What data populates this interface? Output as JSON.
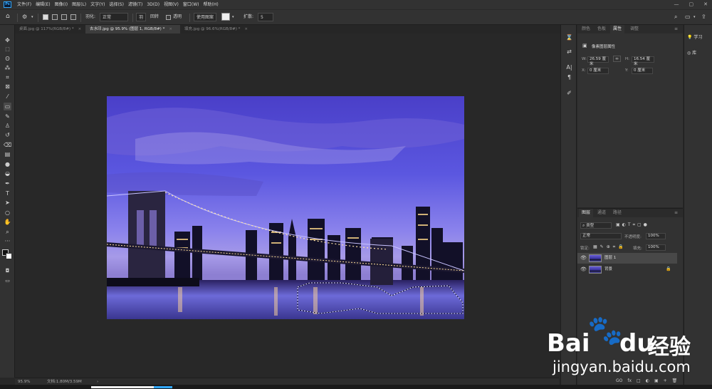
{
  "menubar": {
    "logo": "Ps",
    "items": [
      "文件(F)",
      "编辑(E)",
      "图像(I)",
      "图层(L)",
      "文字(Y)",
      "选择(S)",
      "滤镜(T)",
      "3D(D)",
      "视图(V)",
      "窗口(W)",
      "帮助(H)"
    ],
    "window_controls": [
      "—",
      "▢",
      "✕"
    ]
  },
  "options": {
    "feather_label": "羽化:",
    "feather_value": "正常",
    "btn_a": "羽",
    "btn_b": "回转",
    "transparent_label": "透明",
    "mode_label": "使用图案",
    "spread_label": "扩散:",
    "spread_value": "5"
  },
  "tabs": [
    {
      "label": "桌面.jpg @ 117%(RGB/8#) *",
      "close": "×"
    },
    {
      "label": "去水印.jpg @ 95.9% (图层 1, RGB/8#) *",
      "close": "×"
    },
    {
      "label": "填充.jpg @ 96.6%(RGB/8#) *",
      "close": "×"
    }
  ],
  "status": {
    "zoom": "95.9%",
    "doc": "文档:1.80M/3.59M",
    "arrow": "›"
  },
  "properties": {
    "tabs": [
      "颜色",
      "色板",
      "属性",
      "调整"
    ],
    "subtitle": "像素图层属性",
    "w_label": "W:",
    "w_value": "26.59 厘米",
    "h_label": "H:",
    "h_value": "16.54 厘米",
    "x_label": "X:",
    "x_value": "0 厘米",
    "y_label": "Y:",
    "y_value": "0 厘米",
    "link": "∞"
  },
  "layers": {
    "tabs": [
      "图层",
      "通道",
      "路径"
    ],
    "filter_label": "类型",
    "blend_mode": "正常",
    "opacity_label": "不透明度:",
    "opacity_value": "100%",
    "lock_label": "锁定:",
    "fill_label": "填充:",
    "fill_value": "100%",
    "items": [
      {
        "name": "图层 1"
      },
      {
        "name": "背景"
      }
    ],
    "bottom_icons": [
      "GO",
      "fx",
      "□",
      "◐",
      "▣",
      "+",
      "🗑"
    ]
  },
  "right_panel": {
    "learn": "学习",
    "library": "库"
  },
  "watermark": {
    "brand": "Bai",
    "brand2": "du",
    "cn": "经验",
    "url": "jingyan.baidu.com"
  },
  "colors": {
    "accent": "#31a8ff",
    "panel": "#323232",
    "canvas": "#282828"
  }
}
